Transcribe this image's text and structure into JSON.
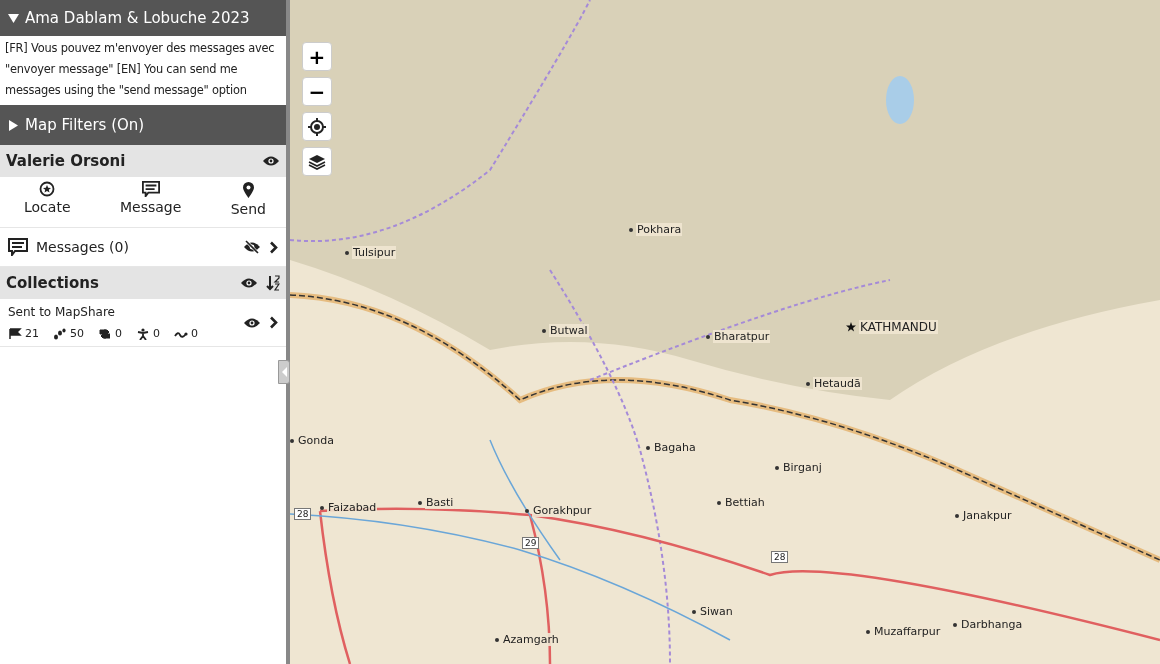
{
  "trip": {
    "title": "Ama Dablam & Lobuche 2023",
    "expanded": true,
    "message": "[FR] Vous pouvez m'envoyer des messages avec \"envoyer message\" [EN] You can send me messages using the \"send message\" option"
  },
  "filters": {
    "label": "Map Filters (On)",
    "expanded": false
  },
  "user": {
    "name": "Valerie Orsoni",
    "visible": true,
    "actions": [
      {
        "kind": "locate",
        "label": "Locate"
      },
      {
        "kind": "message",
        "label": "Message"
      },
      {
        "kind": "send",
        "label": "Send"
      }
    ]
  },
  "messages": {
    "label": "Messages (0)",
    "visible": false
  },
  "collections": {
    "title": "Collections",
    "visible": true,
    "items": [
      {
        "name": "Sent to MapShare",
        "visible": true,
        "counts": [
          {
            "kind": "waypoints",
            "value": "21"
          },
          {
            "kind": "tracks",
            "value": "50"
          },
          {
            "kind": "routes",
            "value": "0"
          },
          {
            "kind": "people",
            "value": "0"
          },
          {
            "kind": "paths",
            "value": "0"
          }
        ]
      }
    ]
  },
  "map": {
    "controls": [
      {
        "kind": "zoom-in",
        "label": "+"
      },
      {
        "kind": "zoom-out",
        "label": "−"
      },
      {
        "kind": "locate"
      },
      {
        "kind": "layers"
      }
    ],
    "places": [
      {
        "name": "Tulsipur",
        "kind": "town"
      },
      {
        "name": "Pokhara",
        "kind": "town"
      },
      {
        "name": "Butwal",
        "kind": "town"
      },
      {
        "name": "Bharatpur",
        "kind": "town"
      },
      {
        "name": "KATHMANDU",
        "kind": "capital"
      },
      {
        "name": "Hetaudā",
        "kind": "town"
      },
      {
        "name": "Gonda",
        "kind": "town"
      },
      {
        "name": "Bagaha",
        "kind": "town"
      },
      {
        "name": "Birganj",
        "kind": "town"
      },
      {
        "name": "Bettiah",
        "kind": "town"
      },
      {
        "name": "Janakpur",
        "kind": "town"
      },
      {
        "name": "Faizabad",
        "kind": "town"
      },
      {
        "name": "Basti",
        "kind": "town"
      },
      {
        "name": "Gorakhpur",
        "kind": "town"
      },
      {
        "name": "Siwan",
        "kind": "town"
      },
      {
        "name": "Azamgarh",
        "kind": "town"
      },
      {
        "name": "Muzaffarpur",
        "kind": "town"
      },
      {
        "name": "Darbhanga",
        "kind": "town"
      }
    ],
    "shields": [
      "28",
      "29",
      "28"
    ]
  }
}
